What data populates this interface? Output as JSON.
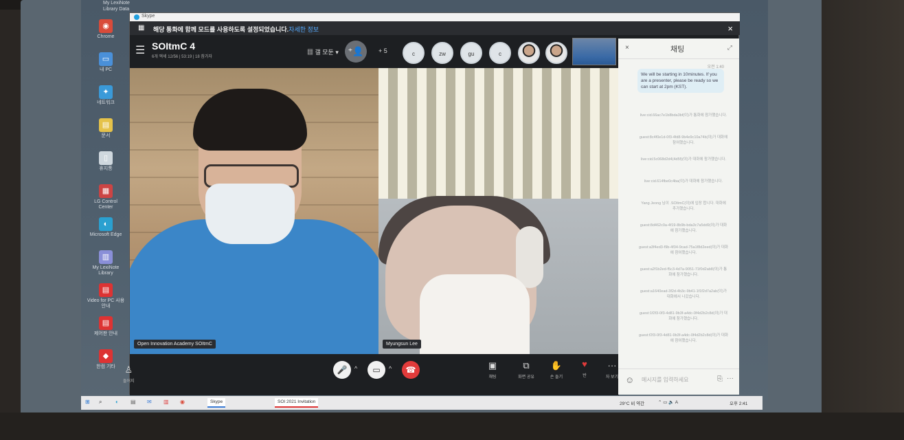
{
  "window": {
    "app_name": "Skype"
  },
  "notice": {
    "text": "해당 통화에 함께 모드를 사용하도록 설정되었습니다.",
    "link": "자세한 정보",
    "close_icon": "×"
  },
  "header": {
    "title": "SOItmC 4",
    "subtitle": "6개 액세 12/56 | 53:19 | 18 참가자",
    "view_label": "▦ 갤 모둔 ▾",
    "add_icon": "⁺👤",
    "plus_count": "+ 5",
    "avatars": [
      {
        "label": "c"
      },
      {
        "label": "zw"
      },
      {
        "label": "gu"
      },
      {
        "label": "c"
      }
    ]
  },
  "videos": {
    "left_name": "Open Innovation Academy SOItmC",
    "right_name": "Myungsun Lee"
  },
  "controls": {
    "mic_icon": "🎤",
    "cam_icon": "▭",
    "hangup_icon": "☎",
    "chevron": "^",
    "left_label": "들어지",
    "chat_label": "채팅",
    "share_label": "화면 공유",
    "raise_label": "손 들기",
    "react_label": "반",
    "more_label": "자 보기"
  },
  "chat": {
    "title": "채팅",
    "close_icon": "×",
    "expand_icon": "⤢",
    "time": "오전 1:40",
    "message": "We will be starting in 10minutes. If you are a presenter, please be ready so we can start at 2pm (KST).",
    "system_messages": [
      "live:cid.66ac7e1b8bda3bf(이)가 통화에 참가했습니다.",
      "guest:8c4f0e1d-0f3-4fd8-9b4e9c10a74b(이)가 대화에 참여했습니다.",
      "live:cid.5c068d2d4(4d5f)(이)가 대화에 참가했습니다.",
      "live:cid.614fbe0c4ba(이)가 대화에 참가했습니다.",
      "Yang Jeong 님이 .SOItmC(이)에 입장 합니다. 대화에 추가했습니다.",
      "guest:8d462c0a-4f19-8b9b-bda3c7a5dd9(이)가 대화에 참가했습니다.",
      "guest:a3f4ed3-f9b-4f34-9cad-75a1f8d2eed(이)가 대화에 참여했습니다.",
      "guest:a2f1b2ed-f5c3-4d7a-9051-71f0d2ab8(이)가 통화에 참가했습니다.",
      "guest:a1640ead-3f2d-4b3c-9b41-1f1f2d7a2ab(이)가 대화에서 나갔습니다.",
      "guest:1f2f3-0f3-4d81-9b3f-a4dc-0f4d2b2c8d(이)가 대화에 참가했습니다.",
      "guest:f2f3-0f3-4d81-9b3f-a4dc-0f4d2b2c8d(이)가 대화에 참여했습니다."
    ],
    "input_placeholder": "메시지를 입력하세요",
    "emoji_icon": "☺",
    "attach_icon": "⎘",
    "more_icon": "···"
  },
  "desktop": {
    "top_label": "My LexiNote Library Data",
    "icons": [
      {
        "label": "Chrome",
        "glyph": "◉",
        "color": "#d94b3a"
      },
      {
        "label": "내 PC",
        "glyph": "▭",
        "color": "#4a90d9"
      },
      {
        "label": "네트워크",
        "glyph": "✦",
        "color": "#3a9ad9"
      },
      {
        "label": "문서",
        "glyph": "▤",
        "color": "#e5c24a"
      },
      {
        "label": "휴지통",
        "glyph": "▯",
        "color": "#cfd8de"
      },
      {
        "label": "LG Control Center",
        "glyph": "▦",
        "color": "#c44"
      },
      {
        "label": "Microsoft Edge",
        "glyph": "◐",
        "color": "#2aa0d0"
      },
      {
        "label": "My LexiNote Library",
        "glyph": "▥",
        "color": "#8a8fd8"
      },
      {
        "label": "Video for PC 사용 안내",
        "glyph": "▤",
        "color": "#d33"
      },
      {
        "label": "제어판 안내",
        "glyph": "▤",
        "color": "#d33"
      },
      {
        "label": "한컴 기타",
        "glyph": "◆",
        "color": "#d33"
      }
    ]
  },
  "taskbar": {
    "start_icon": "⊞",
    "search_icon": "⌕",
    "skype_label": "Skype",
    "doc_label": "SOI 2021 Invitation",
    "weather": "29°C 비 약간",
    "clock": "오후 2:41"
  }
}
